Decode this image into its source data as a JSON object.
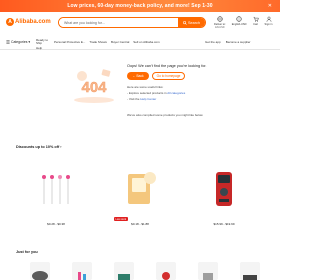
{
  "promo": {
    "text": "Low prices, 60-day money-back policy, and more! Sep 1-30",
    "close": "✕"
  },
  "header": {
    "logo_mark": "A",
    "logo_text": "Alibaba.com",
    "search_placeholder": "What are you looking for...",
    "search_button": "Search",
    "actions": [
      {
        "icon": "globe-icon",
        "label": "Deliver to:",
        "sub": "EN-USD"
      },
      {
        "icon": "globe-icon",
        "label": "English-USD",
        "sub": ""
      },
      {
        "icon": "cart-icon",
        "label": "Cart",
        "sub": ""
      },
      {
        "icon": "user-icon",
        "label": "Sign in",
        "sub": ""
      }
    ]
  },
  "nav": {
    "categories": "Categories",
    "links": [
      "Ready to Ship",
      "Personal Protective E...",
      "Trade Shows",
      "Buyer Central",
      "Sell on Alibaba.com"
    ],
    "help": "Help",
    "right": [
      "Get the app",
      "Become a supplier"
    ]
  },
  "error": {
    "illustration": "404",
    "title": "Oops! We can't find the page you're looking for.",
    "back_button": "Back",
    "home_button": "Go to homepage",
    "links_title": "Here are some useful links:",
    "links": [
      {
        "prefix": "- Explore selected products in",
        "link": "All categories"
      },
      {
        "prefix": "- Visit the",
        "link": "Help Center"
      }
    ],
    "more_text": "We've also compiled some products you might like below"
  },
  "discounts": {
    "title": "Discounts up to 10% off ›",
    "products": [
      {
        "price": "$0.28 - $0.38",
        "badge": ""
      },
      {
        "price": "$0.18 - $1.88",
        "badge": "Low stock"
      },
      {
        "price": "$15.99 - $19.99",
        "badge": ""
      }
    ]
  },
  "jfy": {
    "title": "Just for you"
  },
  "colors": {
    "accent": "#ff6a00",
    "link": "#3366cc",
    "badge": "#e02020"
  }
}
